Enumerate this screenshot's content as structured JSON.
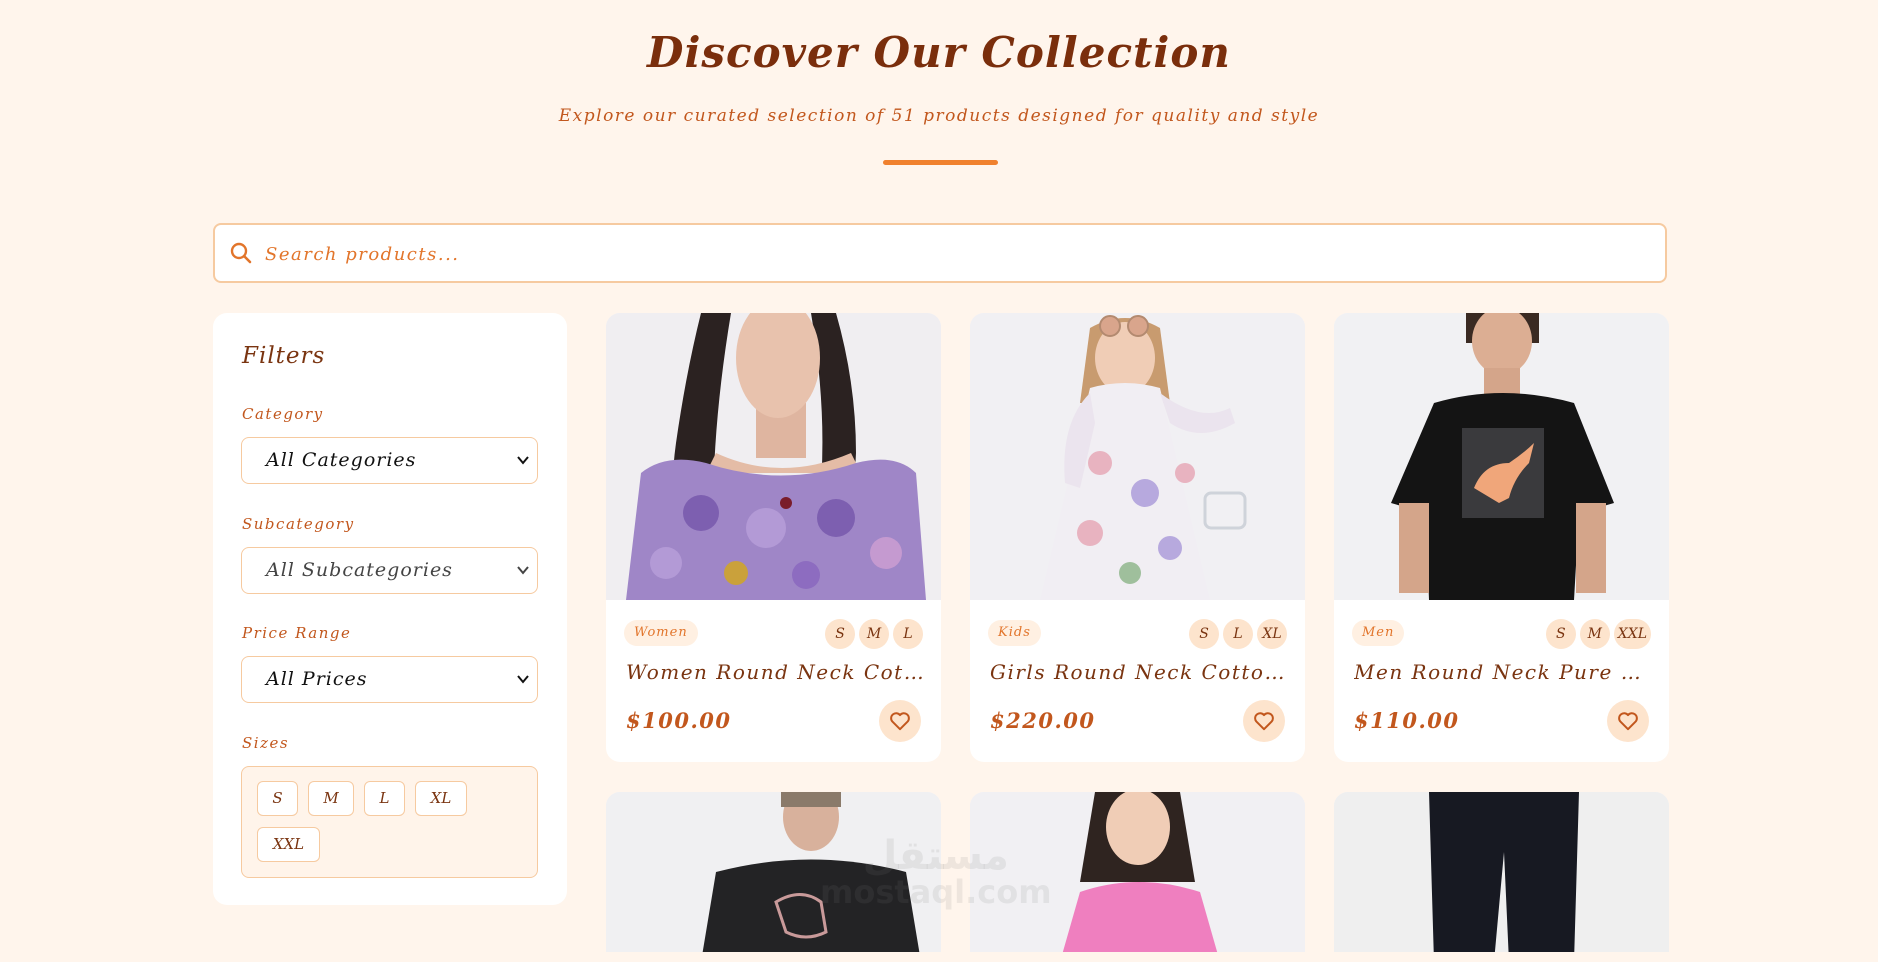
{
  "header": {
    "title": "Discover Our Collection",
    "subtitle": "Explore our curated selection of 51 products designed for quality and style"
  },
  "search": {
    "placeholder": "Search products..."
  },
  "filters": {
    "title": "Filters",
    "category_label": "Category",
    "category_value": "All Categories",
    "subcategory_label": "Subcategory",
    "subcategory_value": "All Subcategories",
    "price_label": "Price Range",
    "price_value": "All Prices",
    "sizes_label": "Sizes",
    "sizes": [
      "S",
      "M",
      "L",
      "XL",
      "XXL"
    ]
  },
  "products": [
    {
      "category": "Women",
      "sizes": [
        "S",
        "M",
        "L"
      ],
      "name": "Women Round Neck Cotton Top",
      "price": "$100.00"
    },
    {
      "category": "Kids",
      "sizes": [
        "S",
        "L",
        "XL"
      ],
      "name": "Girls Round Neck Cotton Top",
      "price": "$220.00"
    },
    {
      "category": "Men",
      "sizes": [
        "S",
        "M",
        "XXL"
      ],
      "name": "Men Round Neck Pure Cotton…",
      "price": "$110.00"
    }
  ],
  "watermark": {
    "arabic": "مستقل",
    "latin": "mostaql.com"
  },
  "colors": {
    "background": "#fff5ec",
    "accent": "#f0812e",
    "text_dark": "#7a3410",
    "text_orange": "#c2571d"
  }
}
